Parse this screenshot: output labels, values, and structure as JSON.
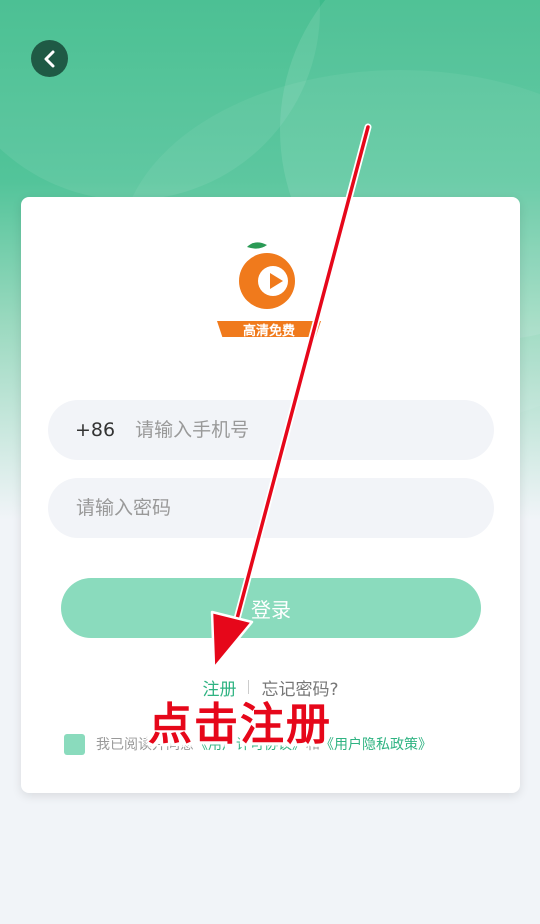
{
  "header": {
    "back_icon": "chevron-left-icon"
  },
  "logo": {
    "badge_text": "高清免费"
  },
  "form": {
    "phone_prefix": "+86",
    "phone_placeholder": "请输入手机号",
    "password_placeholder": "请输入密码",
    "login_label": "登录",
    "register_label": "注册",
    "forgot_label": "忘记密码?"
  },
  "agreement": {
    "prefix": "我已阅读并同意",
    "user_agreement": "《用户许可协议》",
    "conjunction": "和",
    "privacy_policy": "《用户隐私政策》"
  },
  "annotation": {
    "text": "点击注册"
  },
  "colors": {
    "brand_green": "#3dbb8b",
    "button_green": "#8adbbd",
    "link_green": "#2fb382",
    "annotation_red": "#e6071a"
  }
}
